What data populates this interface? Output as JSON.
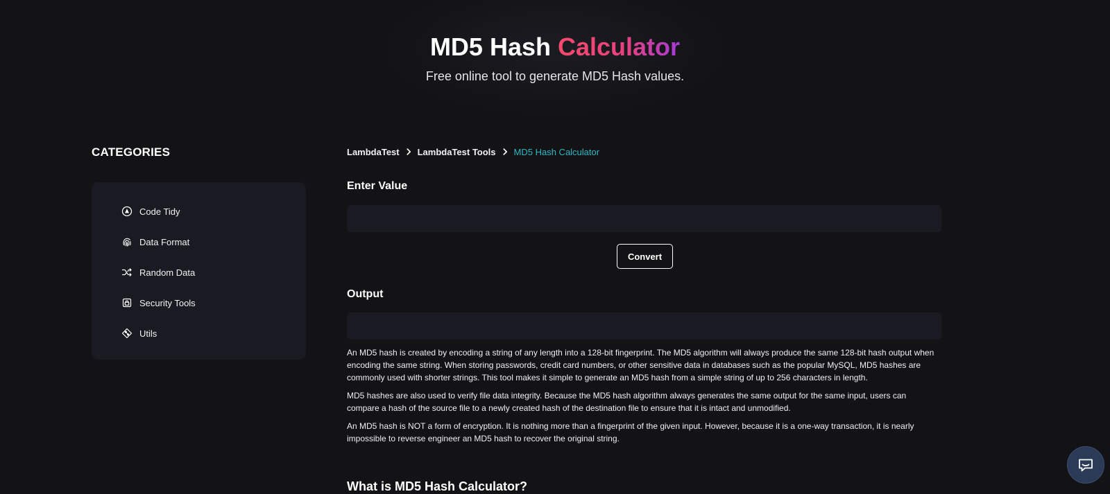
{
  "hero": {
    "title_main": "MD5 Hash",
    "title_accent": "Calculator",
    "subtitle": "Free online tool to generate MD5 Hash values."
  },
  "sidebar": {
    "heading": "CATEGORIES",
    "items": [
      {
        "label": "Code Tidy",
        "icon": "code-tidy-icon"
      },
      {
        "label": "Data Format",
        "icon": "fingerprint-icon"
      },
      {
        "label": "Random Data",
        "icon": "shuffle-icon"
      },
      {
        "label": "Security Tools",
        "icon": "lock-icon"
      },
      {
        "label": "Utils",
        "icon": "git-diamond-icon"
      }
    ]
  },
  "breadcrumb": {
    "items": [
      "LambdaTest",
      "LambdaTest Tools"
    ],
    "current": "MD5 Hash Calculator"
  },
  "form": {
    "input_label": "Enter Value",
    "input_value": "",
    "convert_label": "Convert",
    "output_label": "Output",
    "output_value": ""
  },
  "description": {
    "paragraphs": [
      "An MD5 hash is created by encoding a string of any length into a 128-bit fingerprint. The MD5 algorithm will always produce the same 128-bit hash output when encoding the same string. When storing passwords, credit card numbers, or other sensitive data in databases such as the popular MySQL, MD5 hashes are commonly used with shorter strings. This tool makes it simple to generate an MD5 hash from a simple string of up to 256 characters in length.",
      "MD5 hashes are also used to verify file data integrity. Because the MD5 hash algorithm always generates the same output for the same input, users can compare a hash of the source file to a newly created hash of the destination file to ensure that it is intact and unmodified.",
      "An MD5 hash is NOT a form of encryption. It is nothing more than a fingerprint of the given input. However, because it is a one-way transaction, it is nearly impossible to reverse engineer an MD5 hash to recover the original string."
    ],
    "next_heading": "What is MD5 Hash Calculator?"
  },
  "colors": {
    "background": "#131316",
    "card": "#1a1b22",
    "accent_cyan": "#2fb6c4",
    "accent_pink": "#f44a6c",
    "accent_purple": "#a53bd6",
    "chat_button": "#2b3a57"
  },
  "chat": {
    "icon": "chat-bubble-icon"
  }
}
